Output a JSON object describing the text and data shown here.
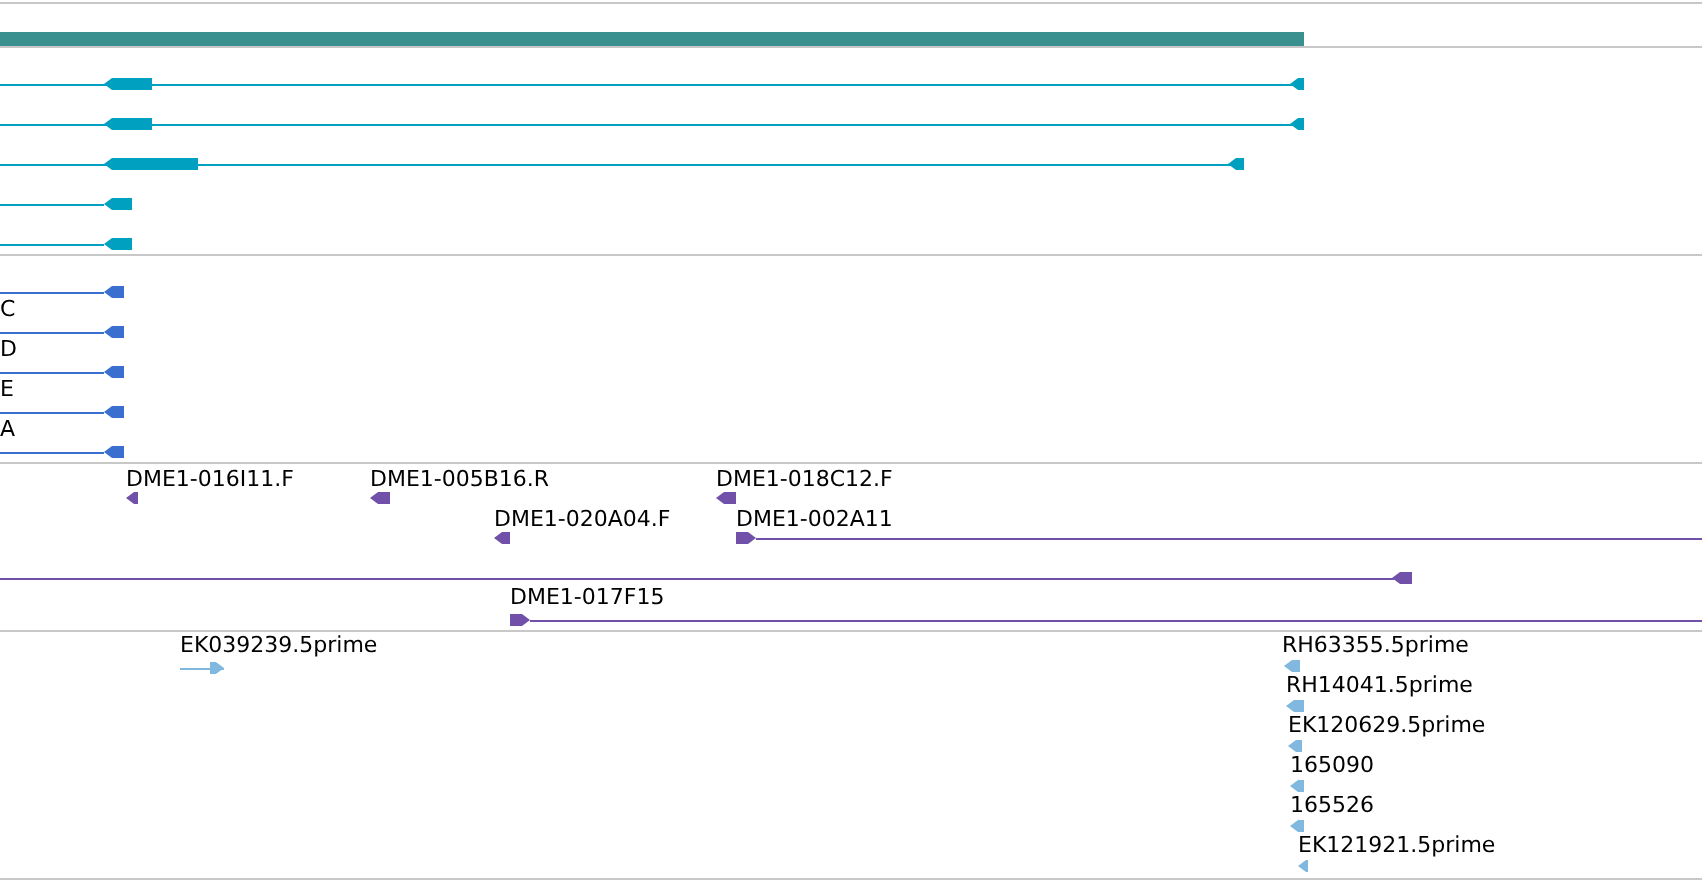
{
  "tracks": [
    {
      "color": "#00a0c0",
      "features": [
        {
          "kind": "reverse"
        },
        {
          "kind": "reverse"
        },
        {
          "kind": "reverse"
        },
        {
          "kind": "reverse"
        },
        {
          "kind": "reverse"
        }
      ]
    },
    {
      "color": "#3a6fd0",
      "features": [
        {
          "kind": "reverse"
        },
        {
          "kind": "reverse",
          "label": "C"
        },
        {
          "kind": "reverse",
          "label": "D"
        },
        {
          "kind": "reverse",
          "label": "E"
        },
        {
          "kind": "reverse",
          "label": "A"
        }
      ]
    },
    {
      "color": "#7050a8",
      "features": [
        {
          "kind": "reverse",
          "label": "DME1-016I11.F"
        },
        {
          "kind": "reverse",
          "label": "DME1-005B16.R"
        },
        {
          "kind": "reverse",
          "label": "DME1-018C12.F"
        },
        {
          "kind": "reverse",
          "label": "DME1-020A04.F"
        },
        {
          "kind": "forward",
          "label": "DME1-002A11"
        },
        {
          "kind": "reverse"
        },
        {
          "kind": "forward",
          "label": "DME1-017F15"
        }
      ]
    },
    {
      "color": "#80b8e0",
      "features": [
        {
          "kind": "forward",
          "label": "EK039239.5prime"
        },
        {
          "kind": "reverse",
          "label": "RH63355.5prime"
        },
        {
          "kind": "reverse",
          "label": "RH14041.5prime"
        },
        {
          "kind": "reverse",
          "label": "EK120629.5prime"
        },
        {
          "kind": "reverse",
          "label": "165090"
        },
        {
          "kind": "reverse",
          "label": "165526"
        },
        {
          "kind": "reverse",
          "label": "EK121921.5prime"
        }
      ]
    }
  ]
}
